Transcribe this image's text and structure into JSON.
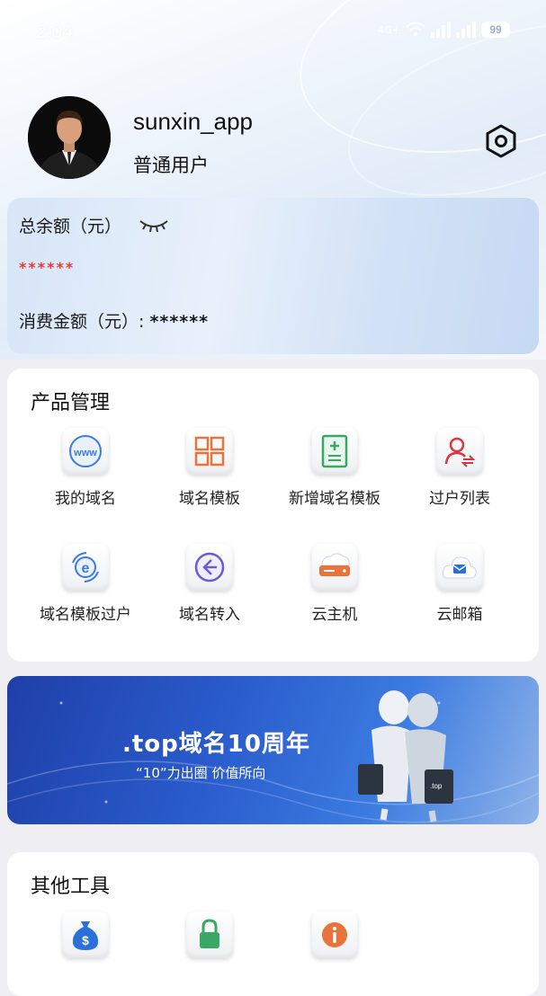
{
  "status_bar": {
    "time": "2:04",
    "battery": "99",
    "network_text": "4G+"
  },
  "profile": {
    "username": "sunxin_app",
    "user_type": "普通用户"
  },
  "balance": {
    "total_label": "总余额（元）",
    "total_value": "******",
    "spend_label": "消费金额（元）:",
    "spend_value": "******"
  },
  "products": {
    "title": "产品管理",
    "items": [
      {
        "label": "我的域名",
        "icon": "www-icon"
      },
      {
        "label": "域名模板",
        "icon": "grid-template-icon"
      },
      {
        "label": "新增域名模板",
        "icon": "add-document-icon"
      },
      {
        "label": "过户列表",
        "icon": "user-transfer-icon"
      },
      {
        "label": "域名模板过户",
        "icon": "e-refresh-icon"
      },
      {
        "label": "域名转入",
        "icon": "arrow-left-circle-icon"
      },
      {
        "label": "云主机",
        "icon": "server-icon"
      },
      {
        "label": "云邮箱",
        "icon": "mail-cloud-icon"
      }
    ]
  },
  "banner": {
    "title": ".top域名10周年",
    "subtitle": "“10”力出圈  价值所向",
    "badge": ".top"
  },
  "tools": {
    "title": "其他工具",
    "items": [
      {
        "icon": "money-bag-icon"
      },
      {
        "icon": "lock-icon"
      },
      {
        "icon": "info-icon"
      }
    ]
  },
  "colors": {
    "accent_red": "#e33b3b",
    "brand_blue": "#2a5ccc",
    "orange": "#e8743b"
  }
}
